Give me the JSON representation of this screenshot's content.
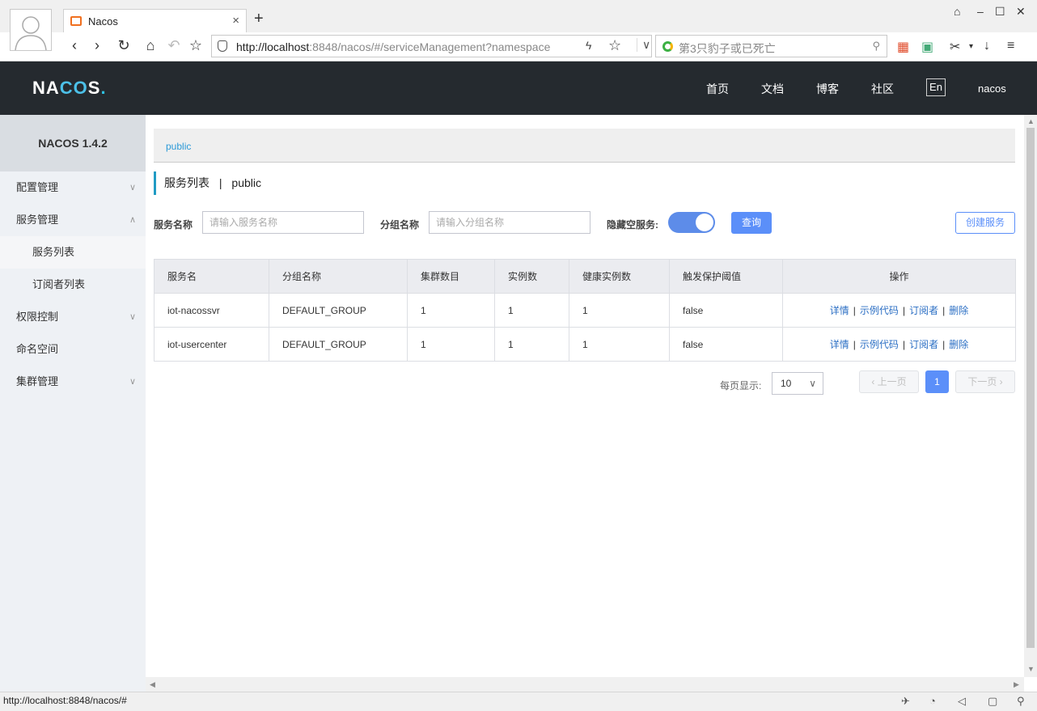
{
  "browser": {
    "tab_title": "Nacos",
    "tab_close": "×",
    "new_tab": "+",
    "address_host": "http://localhost",
    "address_rest": ":8848/nacos/#/serviceManagement?namespace",
    "search_placeholder": "第3只豹子或已死亡",
    "status_url": "http://localhost:8848/nacos/#"
  },
  "header": {
    "nav": [
      "首页",
      "文档",
      "博客",
      "社区"
    ],
    "lang": "En",
    "user": "nacos"
  },
  "sidebar": {
    "title": "NACOS 1.4.2",
    "items": [
      {
        "label": "配置管理",
        "chevron": "∨"
      },
      {
        "label": "服务管理",
        "chevron": "∧"
      },
      {
        "label": "服务列表"
      },
      {
        "label": "订阅者列表"
      },
      {
        "label": "权限控制",
        "chevron": "∨"
      },
      {
        "label": "命名空间"
      },
      {
        "label": "集群管理",
        "chevron": "∨"
      }
    ]
  },
  "main": {
    "namespace": "public",
    "title": "服务列表",
    "title_sep": "|",
    "title_ns": "public",
    "filters": {
      "service_label": "服务名称",
      "service_placeholder": "请输入服务名称",
      "group_label": "分组名称",
      "group_placeholder": "请输入分组名称",
      "hide_empty_label": "隐藏空服务:",
      "hide_empty_on": true,
      "query": "查询",
      "create": "创建服务"
    },
    "table": {
      "columns": [
        "服务名",
        "分组名称",
        "集群数目",
        "实例数",
        "健康实例数",
        "触发保护阈值",
        "操作"
      ],
      "rows": [
        {
          "name": "iot-nacossvr",
          "group": "DEFAULT_GROUP",
          "clusters": "1",
          "instances": "1",
          "healthy": "1",
          "threshold": "false"
        },
        {
          "name": "iot-usercenter",
          "group": "DEFAULT_GROUP",
          "clusters": "1",
          "instances": "1",
          "healthy": "1",
          "threshold": "false"
        }
      ],
      "actions": [
        "详情",
        "示例代码",
        "订阅者",
        "删除"
      ],
      "action_sep": "|"
    },
    "pagination": {
      "page_size_label": "每页显示:",
      "page_size": "10",
      "prev": "上一页",
      "next": "下一页",
      "current": "1"
    }
  },
  "colors": {
    "header_bg": "#252a2f",
    "accent": "#5b8ff9",
    "link": "#2c6fc4",
    "sidebar_bg": "#eef1f5"
  }
}
